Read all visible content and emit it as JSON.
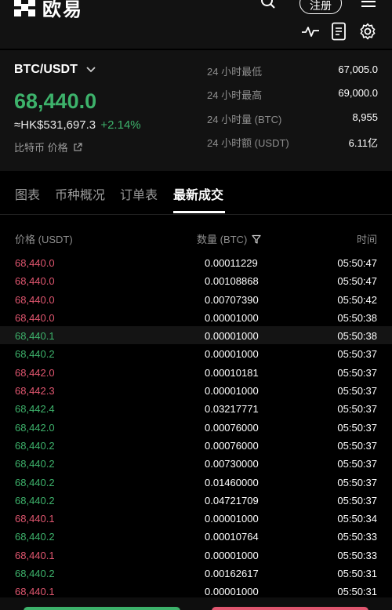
{
  "header": {
    "logo_text": "欧易",
    "register_label": "注册"
  },
  "ticker": {
    "pair": "BTC/USDT",
    "price": "68,440.0",
    "hkd_price": "≈HK$531,697.3",
    "change": "+2.14%",
    "coin_link": "比特币 价格",
    "stats": [
      {
        "label": "24 小时最低",
        "value": "67,005.0"
      },
      {
        "label": "24 小时最高",
        "value": "69,000.0"
      },
      {
        "label": "24 小时量 (BTC)",
        "value": "8,955"
      },
      {
        "label": "24 小时额 (USDT)",
        "value": "6.11亿"
      }
    ]
  },
  "tabs": [
    "图表",
    "币种概况",
    "订单表",
    "最新成交"
  ],
  "active_tab": "最新成交",
  "columns": {
    "price": "价格 (USDT)",
    "amount": "数量 (BTC)",
    "time": "时间"
  },
  "colors": {
    "up": "#3db26b",
    "down": "#e0566f"
  },
  "trades": [
    {
      "price": "68,440.0",
      "amount": "0.00011229",
      "time": "05:50:47",
      "side": "sell"
    },
    {
      "price": "68,440.0",
      "amount": "0.00108868",
      "time": "05:50:47",
      "side": "sell"
    },
    {
      "price": "68,440.0",
      "amount": "0.00707390",
      "time": "05:50:42",
      "side": "sell"
    },
    {
      "price": "68,440.0",
      "amount": "0.00001000",
      "time": "05:50:38",
      "side": "sell"
    },
    {
      "price": "68,440.1",
      "amount": "0.00001000",
      "time": "05:50:38",
      "side": "buy"
    },
    {
      "price": "68,440.2",
      "amount": "0.00001000",
      "time": "05:50:37",
      "side": "buy"
    },
    {
      "price": "68,442.0",
      "amount": "0.00010181",
      "time": "05:50:37",
      "side": "sell"
    },
    {
      "price": "68,442.3",
      "amount": "0.00001000",
      "time": "05:50:37",
      "side": "sell"
    },
    {
      "price": "68,442.4",
      "amount": "0.03217771",
      "time": "05:50:37",
      "side": "buy"
    },
    {
      "price": "68,442.0",
      "amount": "0.00076000",
      "time": "05:50:37",
      "side": "buy"
    },
    {
      "price": "68,440.2",
      "amount": "0.00076000",
      "time": "05:50:37",
      "side": "buy"
    },
    {
      "price": "68,440.2",
      "amount": "0.00730000",
      "time": "05:50:37",
      "side": "buy"
    },
    {
      "price": "68,440.2",
      "amount": "0.01460000",
      "time": "05:50:37",
      "side": "buy"
    },
    {
      "price": "68,440.2",
      "amount": "0.04721709",
      "time": "05:50:37",
      "side": "buy"
    },
    {
      "price": "68,440.1",
      "amount": "0.00001000",
      "time": "05:50:34",
      "side": "sell"
    },
    {
      "price": "68,440.2",
      "amount": "0.00010764",
      "time": "05:50:33",
      "side": "buy"
    },
    {
      "price": "68,440.1",
      "amount": "0.00001000",
      "time": "05:50:33",
      "side": "sell"
    },
    {
      "price": "68,440.2",
      "amount": "0.00162617",
      "time": "05:50:31",
      "side": "buy"
    },
    {
      "price": "68,440.1",
      "amount": "0.00001000",
      "time": "05:50:31",
      "side": "sell"
    }
  ]
}
